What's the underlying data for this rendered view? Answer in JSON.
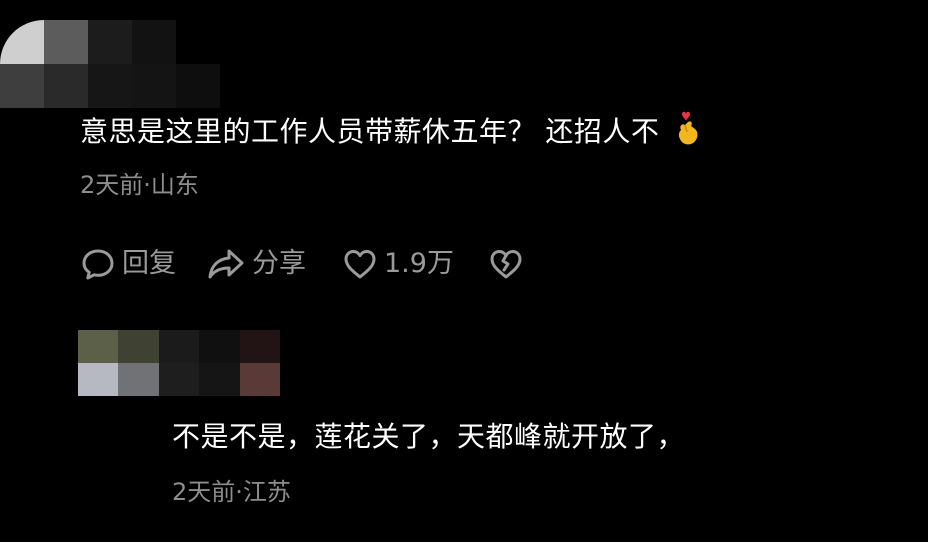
{
  "comments": [
    {
      "text": "意思是这里的工作人员带薪休五年？ 还招人不",
      "emoji_icon": "heart-hand-icon",
      "meta": "2天前·山东",
      "actions": {
        "reply_label": "回复",
        "share_label": "分享",
        "like_count": "1.9万"
      }
    },
    {
      "text": "不是不是，莲花关了，天都峰就开放了，",
      "meta": "2天前·江苏"
    }
  ],
  "colors": {
    "background": "#000000",
    "text": "#ffffff",
    "meta": "#8d8d8d",
    "action": "#9a9a9a",
    "emoji_hand": "#f2b71c",
    "emoji_heart": "#e8344a"
  }
}
